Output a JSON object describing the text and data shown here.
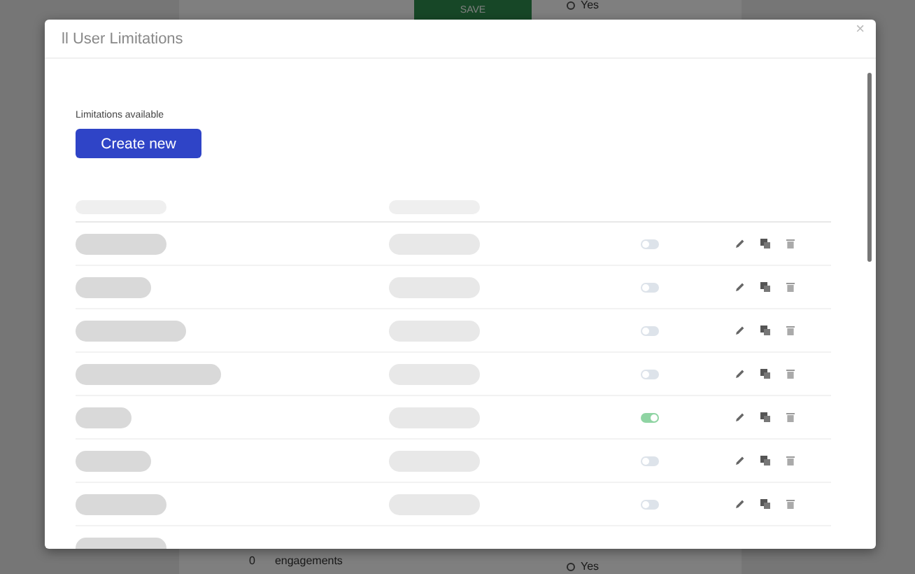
{
  "background_page": {
    "save_button": "SAVE",
    "top_option": {
      "label": "Yes",
      "selected": false
    },
    "footer_count": "0",
    "footer_label": "engagements",
    "bottom_option": {
      "label": "Yes",
      "selected": false
    }
  },
  "modal": {
    "title": "ll User Limitations",
    "close": "×",
    "section_label": "Limitations available",
    "create_button": "Create new",
    "rows": [
      {
        "enabled": false
      },
      {
        "enabled": false
      },
      {
        "enabled": false
      },
      {
        "enabled": false
      },
      {
        "enabled": true
      },
      {
        "enabled": false
      },
      {
        "enabled": false
      }
    ]
  }
}
